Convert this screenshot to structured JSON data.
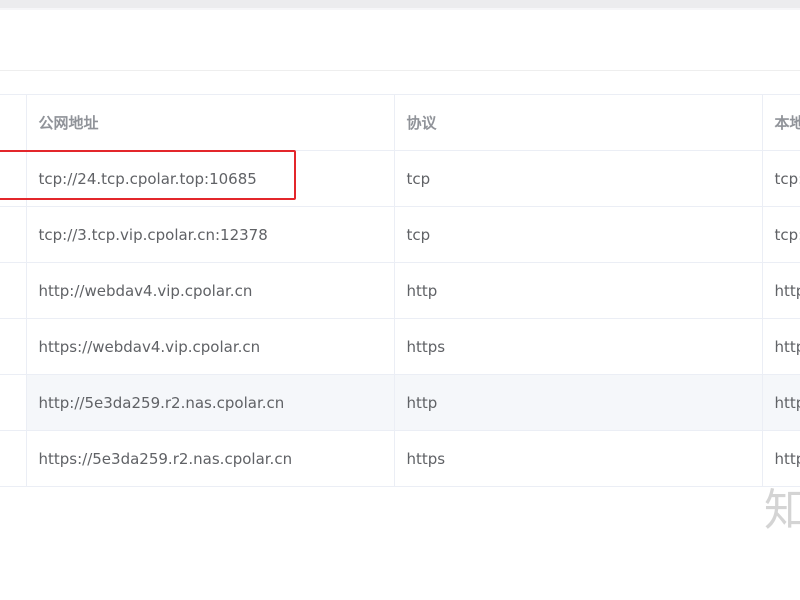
{
  "table": {
    "columns": [
      "",
      "公网地址",
      "协议",
      "本地"
    ],
    "rows": [
      {
        "url": "tcp://24.tcp.cpolar.top:10685",
        "protocol": "tcp",
        "local": "tcp:"
      },
      {
        "url": "tcp://3.tcp.vip.cpolar.cn:12378",
        "protocol": "tcp",
        "local": "tcp:"
      },
      {
        "url": "http://webdav4.vip.cpolar.cn",
        "protocol": "http",
        "local": "http"
      },
      {
        "url": "https://webdav4.vip.cpolar.cn",
        "protocol": "https",
        "local": "http"
      },
      {
        "url": "http://5e3da259.r2.nas.cpolar.cn",
        "protocol": "http",
        "local": "http"
      },
      {
        "url": "https://5e3da259.r2.nas.cpolar.cn",
        "protocol": "https",
        "local": "http"
      }
    ],
    "highlighted_row_index": 0,
    "hover_row_index": 4
  },
  "watermark": {
    "text": "知"
  },
  "colors": {
    "highlight_border": "#e3262b",
    "header_text": "#909399",
    "cell_text": "#606266",
    "row_hover": "#f5f7fa",
    "border": "#ebeef5"
  }
}
